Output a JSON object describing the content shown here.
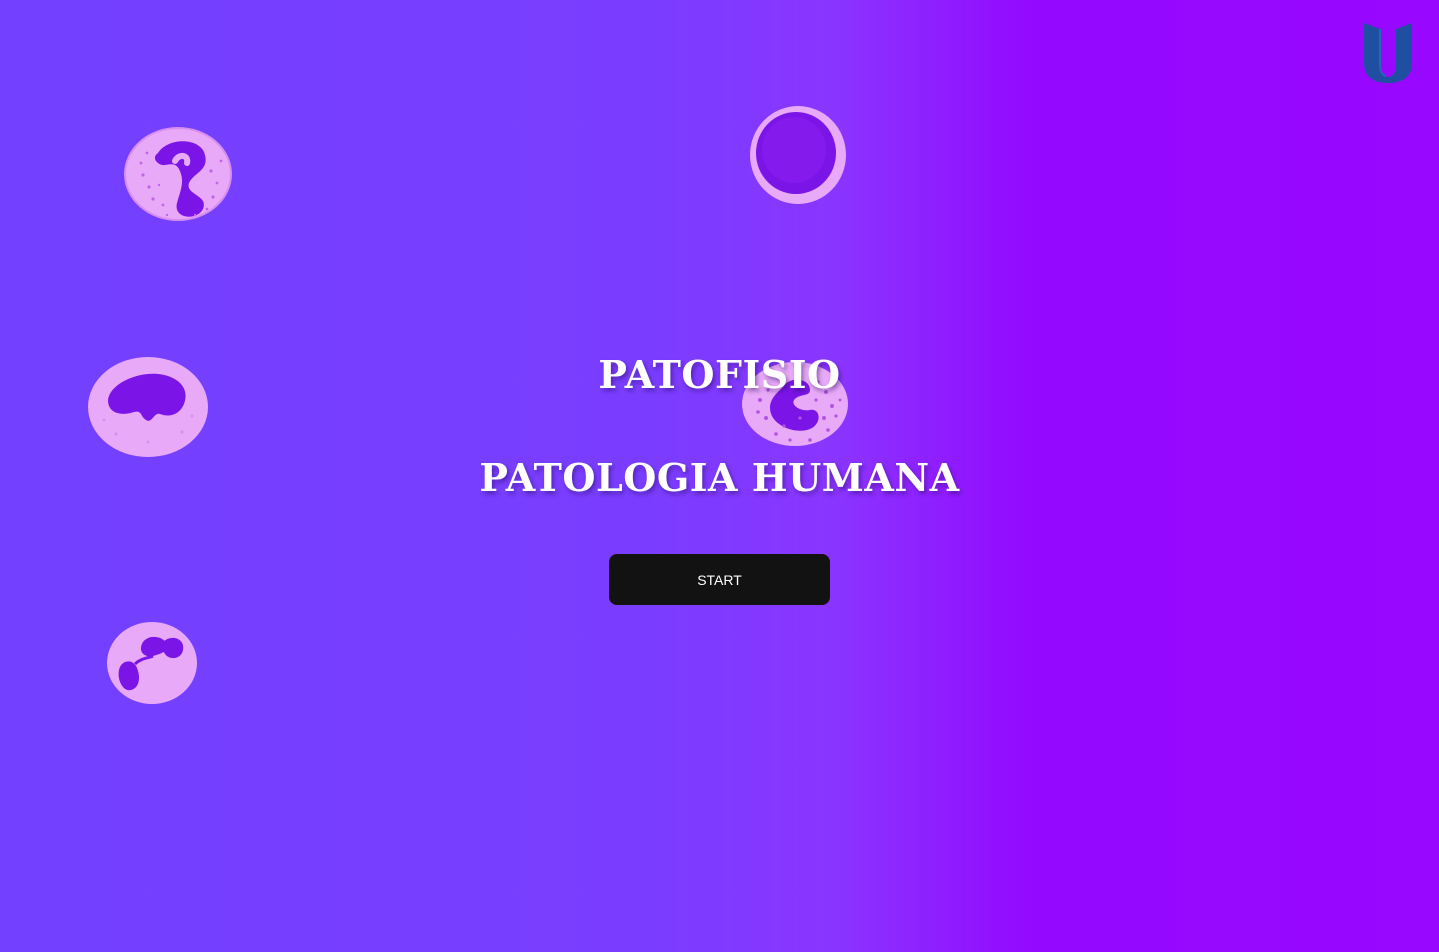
{
  "app": {
    "title_main": "PATOFISIO",
    "title_sub": "PATOLOGIA HUMANA",
    "start_label": "START"
  },
  "decorations": {
    "cells": [
      {
        "name": "granulocyte-cell-icon",
        "kind": "neutrophil"
      },
      {
        "name": "lymphocyte-cell-icon",
        "kind": "lymphocyte"
      },
      {
        "name": "monocyte-cell-icon",
        "kind": "monocyte"
      },
      {
        "name": "basophil-cell-icon",
        "kind": "basophil"
      },
      {
        "name": "eosinophil-cell-icon",
        "kind": "eosinophil"
      }
    ],
    "logo": "u-logo-icon"
  },
  "colors": {
    "background_start": "#7340ff",
    "background_end": "#9807ff",
    "cell_cytoplasm": "#e7a8f7",
    "cell_nucleus": "#7b14e6",
    "button_bg": "#121212",
    "button_text": "#ffffff",
    "logo": "#1f4fa0"
  }
}
